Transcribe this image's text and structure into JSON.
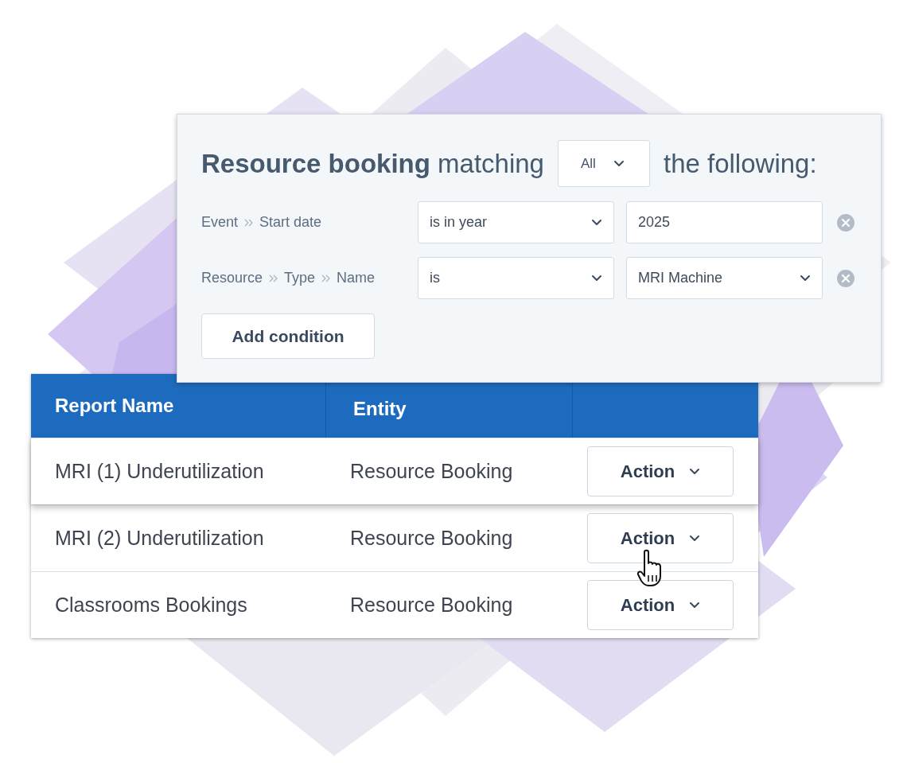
{
  "filter": {
    "title_start": "**Resource booking** matching",
    "match_select": {
      "value": "All"
    },
    "title_end": "the following:",
    "conditions": [
      {
        "field_path": [
          "Event",
          "Start date"
        ],
        "operator": "is in year",
        "value": "2025",
        "kind": "text"
      },
      {
        "field_path": [
          "Resource",
          "Type",
          "Name"
        ],
        "operator": "is",
        "value": "MRI Machine",
        "kind": "select"
      }
    ],
    "add_button": "Add condition"
  },
  "table": {
    "columns": [
      "Report Name",
      "Entity"
    ],
    "rows": [
      {
        "report_name": "MRI (1) Underutilization",
        "entity": "Resource Booking",
        "action": "Action",
        "hovered": true
      },
      {
        "report_name": "MRI (2) Underutilization",
        "entity": "Resource Booking",
        "action": "Action",
        "hovered": false
      },
      {
        "report_name": "Classrooms Bookings",
        "entity": "Resource Booking",
        "action": "Action",
        "hovered": false
      }
    ]
  }
}
